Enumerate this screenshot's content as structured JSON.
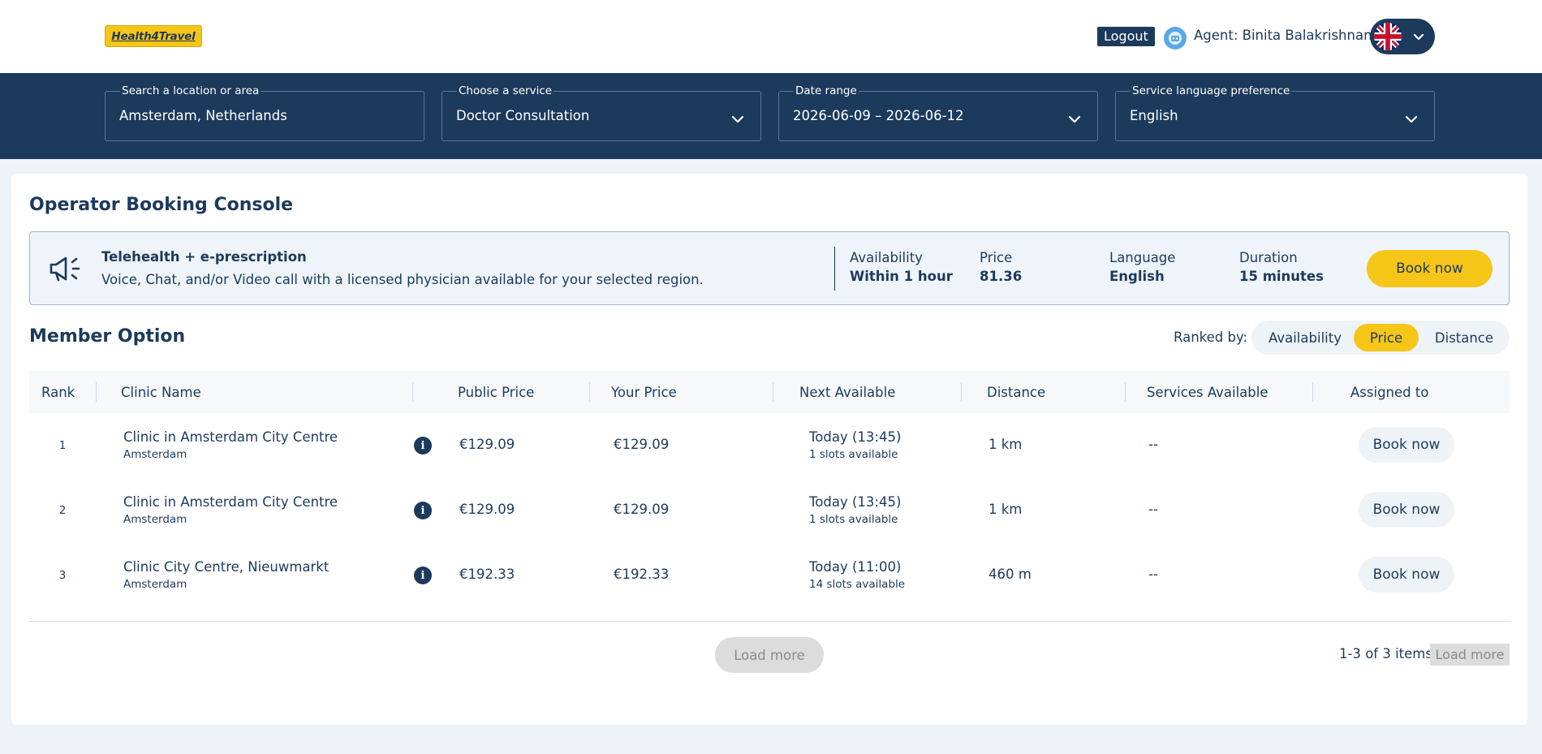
{
  "header": {
    "logo_text": "Health4Travel",
    "logout_label": "Logout",
    "agent_label": "Agent: Binita Balakrishnan",
    "language_flag": "uk-flag"
  },
  "search": {
    "location": {
      "label": "Search a location or area",
      "value": "Amsterdam, Netherlands"
    },
    "service": {
      "label": "Choose a service",
      "value": "Doctor Consultation"
    },
    "date_range": {
      "label": "Date range",
      "value": "2026-06-09 – 2026-06-12"
    },
    "language": {
      "label": "Service language preference",
      "value": "English"
    }
  },
  "console": {
    "title": "Operator Booking Console",
    "promo": {
      "title": "Telehealth + e-prescription",
      "description": "Voice, Chat, and/or Video call with a licensed physician available for your selected region.",
      "availability_label": "Availability",
      "availability_value": "Within 1 hour",
      "price_label": "Price",
      "price_value": "81.36",
      "language_label": "Language",
      "language_value": "English",
      "duration_label": "Duration",
      "duration_value": "15 minutes",
      "book_label": "Book now"
    }
  },
  "member": {
    "title": "Member Option",
    "ranked_by_label": "Ranked by:",
    "ranking_options": [
      "Availability",
      "Price",
      "Distance"
    ],
    "active_ranking": "Price"
  },
  "table": {
    "columns": [
      "Rank",
      "Clinic Name",
      "Public Price",
      "Your Price",
      "Next Available",
      "Distance",
      "Services Available",
      "Assigned to"
    ],
    "rows": [
      {
        "rank": "1",
        "name": "Clinic in Amsterdam City Centre",
        "city": "Amsterdam",
        "public_price": "€129.09",
        "your_price": "€129.09",
        "next": "Today (13:45)",
        "slots": "1 slots available",
        "distance": "1 km",
        "services": "--",
        "book": "Book now"
      },
      {
        "rank": "2",
        "name": "Clinic in Amsterdam City Centre",
        "city": "Amsterdam",
        "public_price": "€129.09",
        "your_price": "€129.09",
        "next": "Today (13:45)",
        "slots": "1 slots available",
        "distance": "1 km",
        "services": "--",
        "book": "Book now"
      },
      {
        "rank": "3",
        "name": "Clinic City Centre, Nieuwmarkt",
        "city": "Amsterdam",
        "public_price": "€192.33",
        "your_price": "€192.33",
        "next": "Today (11:00)",
        "slots": "14 slots available",
        "distance": "460 m",
        "services": "--",
        "book": "Book now"
      }
    ]
  },
  "footer": {
    "load_more_label": "Load more",
    "items_count": "1-3 of 3 items",
    "load_more_small_label": "Load more"
  },
  "colors": {
    "navy": "#1c3a5c",
    "accent_yellow": "#f5c518",
    "page_bg": "#eef3f8"
  }
}
